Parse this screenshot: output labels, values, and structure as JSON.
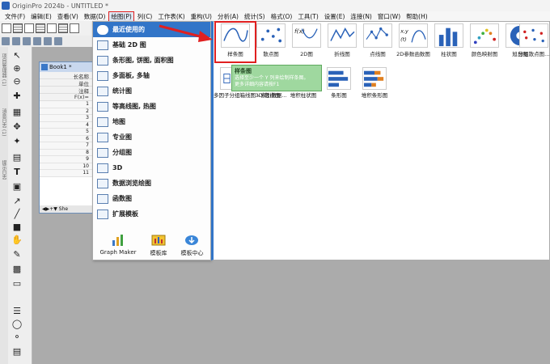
{
  "window": {
    "title": "OriginPro 2024b - UNTITLED *"
  },
  "menubar": {
    "items": [
      {
        "label": "文件(F)"
      },
      {
        "label": "编辑(E)"
      },
      {
        "label": "查看(V)"
      },
      {
        "label": "数据(D)"
      },
      {
        "label": "绘图(P)",
        "active": true
      },
      {
        "label": "列(C)"
      },
      {
        "label": "工作表(K)"
      },
      {
        "label": "重构(U)"
      },
      {
        "label": "分析(A)"
      },
      {
        "label": "统计(S)"
      },
      {
        "label": "格式(O)"
      },
      {
        "label": "工具(T)"
      },
      {
        "label": "设置(E)"
      },
      {
        "label": "连接(N)"
      },
      {
        "label": "窗口(W)"
      },
      {
        "label": "帮助(H)"
      }
    ],
    "highlight_color": "#e02020"
  },
  "side_tabs": [
    "项目管理器 (1)",
    "消息日志 (1)",
    "提示日志"
  ],
  "book": {
    "title": "Book1 *",
    "header_rows": [
      "长名称",
      "单位",
      "注释",
      "F(x)="
    ],
    "rows": [
      "1",
      "2",
      "3",
      "4",
      "5",
      "6",
      "7",
      "8",
      "9",
      "10",
      "11"
    ],
    "sheet_tab": "She"
  },
  "plot_menu": {
    "items": [
      {
        "label": "最近使用的",
        "icon": "clock-icon",
        "active": true
      },
      {
        "label": "基础 2D 图",
        "icon": "line-chart-icon"
      },
      {
        "label": "条形图, 饼图, 面积图",
        "icon": "bar-chart-icon"
      },
      {
        "label": "多面板, 多轴",
        "icon": "multi-panel-icon"
      },
      {
        "label": "统计图",
        "icon": "histogram-icon"
      },
      {
        "label": "等高线图, 热图",
        "icon": "contour-icon"
      },
      {
        "label": "地图",
        "icon": "map-icon"
      },
      {
        "label": "专业图",
        "icon": "polar-icon"
      },
      {
        "label": "分组图",
        "icon": "group-icon"
      },
      {
        "label": "3D",
        "icon": "3d-icon"
      },
      {
        "label": "数据浏览绘图",
        "icon": "browse-icon"
      },
      {
        "label": "函数图",
        "icon": "function-icon"
      },
      {
        "label": "扩展模板",
        "icon": "template-icon"
      }
    ],
    "bottom_buttons": [
      {
        "label": "Graph Maker",
        "icon": "graph-maker-icon"
      },
      {
        "label": "模板库",
        "icon": "template-library-icon"
      },
      {
        "label": "模板中心",
        "icon": "cloud-download-icon"
      }
    ],
    "active_color": "#3275c8"
  },
  "gallery": {
    "recent": [
      {
        "label": "样条图",
        "selected": true
      },
      {
        "label": "散点图"
      },
      {
        "label": "2D图"
      },
      {
        "label": "折线图"
      },
      {
        "label": "点线图"
      },
      {
        "label": "2D参数函数图"
      },
      {
        "label": "柱状图"
      },
      {
        "label": "颜色映射图"
      },
      {
        "label": "旭日图"
      },
      {
        "label": "分组散点图..."
      }
    ],
    "row2": [
      {
        "label": "多因子分组箱线图 - 索引数据..."
      },
      {
        "label": "3D 散点图"
      },
      {
        "label": "堆积柱状图"
      },
      {
        "label": "条形图"
      },
      {
        "label": "堆积条形图"
      }
    ]
  },
  "tooltip": {
    "title": "样条图",
    "line1": "选择至少一个 Y 列来绘制样条图。",
    "line2": "更多详细内容请按F1"
  }
}
